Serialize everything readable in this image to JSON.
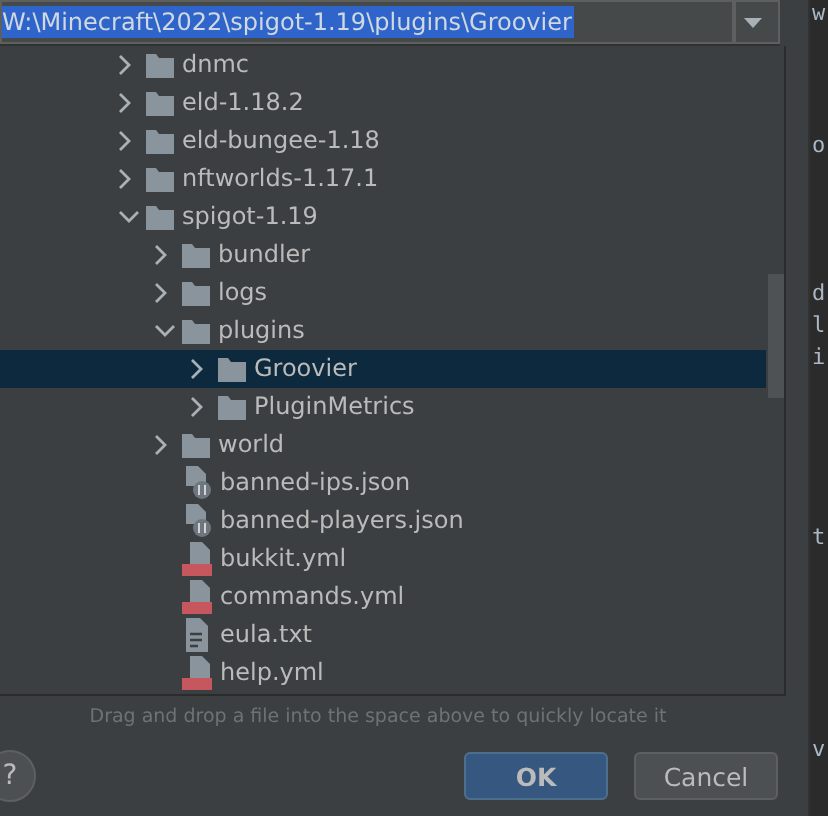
{
  "path_field": {
    "value": "W:\\Minecraft\\2022\\spigot-1.19\\plugins\\Groovier"
  },
  "tree": [
    {
      "kind": "folder",
      "label": "dnmc",
      "expanded": false,
      "selected": false
    },
    {
      "kind": "folder",
      "label": "eld-1.18.2",
      "expanded": false,
      "selected": false
    },
    {
      "kind": "folder",
      "label": "eld-bungee-1.18",
      "expanded": false,
      "selected": false
    },
    {
      "kind": "folder",
      "label": "nftworlds-1.17.1",
      "expanded": false,
      "selected": false
    },
    {
      "kind": "folder",
      "label": "spigot-1.19",
      "expanded": true,
      "selected": false,
      "children": [
        {
          "kind": "folder",
          "label": "bundler",
          "expanded": false,
          "selected": false
        },
        {
          "kind": "folder",
          "label": "logs",
          "expanded": false,
          "selected": false
        },
        {
          "kind": "folder",
          "label": "plugins",
          "expanded": true,
          "selected": false,
          "children": [
            {
              "kind": "folder",
              "label": "Groovier",
              "expanded": false,
              "selected": true
            },
            {
              "kind": "folder",
              "label": "PluginMetrics",
              "expanded": false,
              "selected": false
            }
          ]
        },
        {
          "kind": "folder",
          "label": "world",
          "expanded": false,
          "selected": false
        },
        {
          "kind": "json",
          "label": "banned-ips.json",
          "selected": false
        },
        {
          "kind": "json",
          "label": "banned-players.json",
          "selected": false
        },
        {
          "kind": "yml",
          "label": "bukkit.yml",
          "selected": false
        },
        {
          "kind": "yml",
          "label": "commands.yml",
          "selected": false
        },
        {
          "kind": "txt",
          "label": "eula.txt",
          "selected": false
        },
        {
          "kind": "yml",
          "label": "help.yml",
          "selected": false
        }
      ]
    }
  ],
  "hint": "Drag and drop a file into the space above to quickly locate it",
  "help_button": {
    "label": "?"
  },
  "buttons": [
    {
      "label": "OK",
      "primary": true
    },
    {
      "label": "Cancel",
      "primary": false
    }
  ],
  "editor_fragments": [
    "w",
    "o",
    "d",
    "l",
    "i",
    "t",
    "v"
  ]
}
